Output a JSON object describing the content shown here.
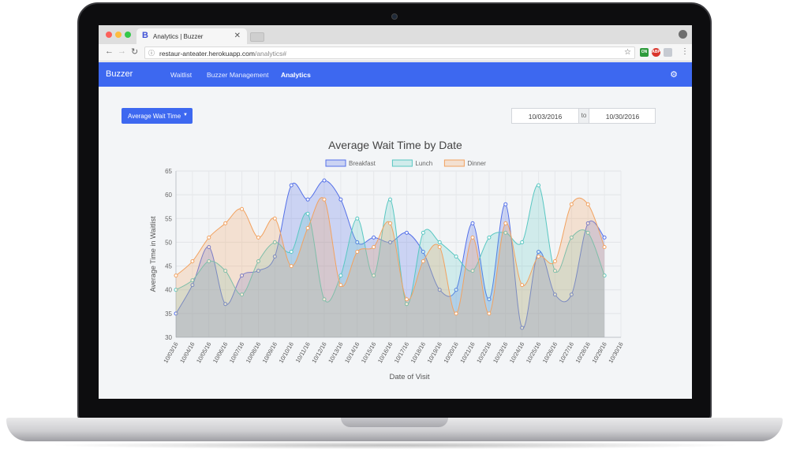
{
  "browser": {
    "tab_title": "Analytics | Buzzer",
    "favicon_letter": "B",
    "url_host": "restaur-anteater.herokuapp.com",
    "url_path": "/analytics#",
    "extensions": [
      "ON",
      "ABP",
      ""
    ]
  },
  "navbar": {
    "brand": "Buzzer",
    "items": [
      {
        "label": "Waitlist",
        "active": false
      },
      {
        "label": "Buzzer Management",
        "active": false
      },
      {
        "label": "Analytics",
        "active": true
      }
    ]
  },
  "controls": {
    "metric_dropdown": "Average Wait Time",
    "date_from": "10/03/2016",
    "date_sep": "to",
    "date_to": "10/30/2016"
  },
  "chart_data": {
    "type": "area",
    "title": "Average Wait Time by Date",
    "xlabel": "Date of Visit",
    "ylabel": "Average Time in Waitlist",
    "ylim": [
      30,
      65
    ],
    "yticks": [
      30,
      35,
      40,
      45,
      50,
      55,
      60,
      65
    ],
    "grid": true,
    "legend_position": "top",
    "categories": [
      "10/03/16",
      "10/04/16",
      "10/05/16",
      "10/06/16",
      "10/07/16",
      "10/08/16",
      "10/09/16",
      "10/10/16",
      "10/11/16",
      "10/12/16",
      "10/13/16",
      "10/14/16",
      "10/15/16",
      "10/16/16",
      "10/17/16",
      "10/18/16",
      "10/19/16",
      "10/20/16",
      "10/21/16",
      "10/22/16",
      "10/23/16",
      "10/24/16",
      "10/25/16",
      "10/26/16",
      "10/27/16",
      "10/28/16",
      "10/29/16",
      "10/30/16"
    ],
    "series": [
      {
        "name": "Breakfast",
        "color": "#5470e8",
        "fill": "rgba(84,112,232,0.25)",
        "values": [
          35,
          41,
          49,
          37,
          43,
          44,
          47,
          62,
          59,
          63,
          59,
          50,
          51,
          50,
          52,
          48,
          40,
          40,
          54,
          38,
          58,
          32,
          48,
          39,
          39,
          54,
          51,
          null
        ]
      },
      {
        "name": "Lunch",
        "color": "#58c7c2",
        "fill": "rgba(88,199,194,0.22)",
        "values": [
          40,
          42,
          46,
          44,
          39,
          46,
          50,
          48,
          56,
          38,
          43,
          55,
          43,
          59,
          37,
          52,
          50,
          47,
          44,
          51,
          52,
          50,
          62,
          44,
          51,
          52,
          43,
          null
        ]
      },
      {
        "name": "Dinner",
        "color": "#f2a260",
        "fill": "rgba(242,162,96,0.25)",
        "values": [
          43,
          46,
          51,
          54,
          57,
          51,
          55,
          45,
          53,
          59,
          41,
          48,
          49,
          54,
          38,
          46,
          49,
          35,
          51,
          35,
          54,
          41,
          47,
          46,
          58,
          58,
          49,
          null
        ]
      }
    ]
  }
}
